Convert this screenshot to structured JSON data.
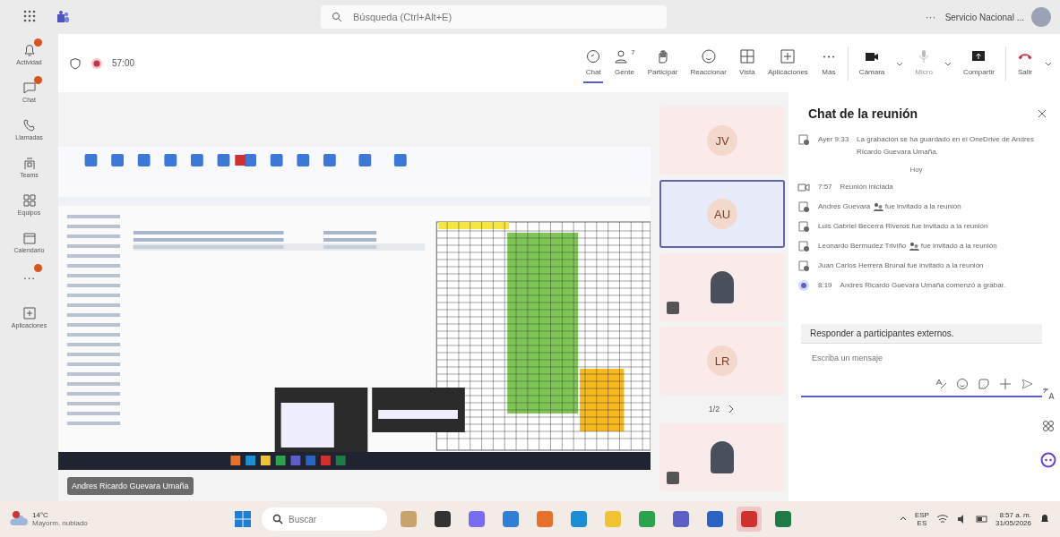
{
  "title_bar": {
    "search": {
      "placeholder": "Búsqueda (Ctrl+Alt+E)"
    },
    "more": "···",
    "account": "Servicio Nacional ..."
  },
  "rail": [
    {
      "kind": "bell",
      "label": "Actividad",
      "badge": true
    },
    {
      "kind": "chat",
      "label": "Chat",
      "badge": true
    },
    {
      "kind": "phone",
      "label": "Llamadas",
      "badge": false
    },
    {
      "kind": "teams",
      "label": "Teams",
      "badge": false
    },
    {
      "kind": "grid",
      "label": "Equipos",
      "badge": false
    },
    {
      "kind": "calendar",
      "label": "Calendario",
      "badge": false
    },
    {
      "kind": "dots",
      "label": "···",
      "badge": true
    },
    {
      "kind": "apps",
      "label": "Aplicaciones",
      "badge": false
    }
  ],
  "meeting": {
    "timer": "57:00",
    "recording": true
  },
  "toolbar": [
    {
      "kind": "chat",
      "label": "Chat",
      "selected": true,
      "disabled": false
    },
    {
      "kind": "people",
      "label": "Gente",
      "selected": false,
      "disabled": false,
      "count": "7"
    },
    {
      "kind": "hand",
      "label": "Participar",
      "selected": false,
      "disabled": false
    },
    {
      "kind": "smile",
      "label": "Reaccionar",
      "selected": false,
      "disabled": false
    },
    {
      "kind": "view",
      "label": "Vista",
      "selected": false,
      "disabled": false
    },
    {
      "kind": "plus",
      "label": "Aplicaciones",
      "selected": false,
      "disabled": false
    },
    {
      "kind": "more",
      "label": "Más",
      "selected": false,
      "disabled": false
    },
    {
      "kind": "camera",
      "label": "Cámara",
      "selected": false,
      "disabled": false,
      "caret": true
    },
    {
      "kind": "mic",
      "label": "Micro",
      "selected": false,
      "disabled": true,
      "caret": true
    },
    {
      "kind": "share",
      "label": "Compartir",
      "selected": false,
      "disabled": false
    },
    {
      "kind": "leave",
      "label": "Salir",
      "selected": false,
      "disabled": false,
      "caret": true
    }
  ],
  "presenter": {
    "name": "Andres Ricardo Guevara Umaña"
  },
  "participants": [
    {
      "kind": "initials",
      "initials": "JV",
      "selected": false
    },
    {
      "kind": "initials",
      "initials": "AU",
      "selected": true
    },
    {
      "kind": "video",
      "selected": false
    },
    {
      "kind": "initials",
      "initials": "LR",
      "selected": false
    },
    {
      "kind": "pager",
      "text": "1/2"
    },
    {
      "kind": "video",
      "selected": false
    }
  ],
  "chat": {
    "title": "Chat de la reunión",
    "messages": [
      {
        "kind": "saved",
        "time": "Ayer 9:33",
        "text": "La grabación se ha guardado en el OneDrive de Andres Ricardo Guevara Umaña."
      },
      {
        "kind": "divider",
        "text": "Hoy"
      },
      {
        "kind": "started",
        "time": "7:57",
        "text": "Reunión iniciada"
      },
      {
        "kind": "invite",
        "name": "Andres Guevara",
        "external": true,
        "text": "fue invitado a la reunión"
      },
      {
        "kind": "invite",
        "text": "Luis Gabriel Becerra Riveros fue invitado a la reunión"
      },
      {
        "kind": "invite",
        "name": "Leonardo Bermudez Triviño",
        "external": true,
        "text": "fue invitado a la reunión"
      },
      {
        "kind": "invite",
        "text": "Juan Carlos Herrera Brunal fue invitado a la reunión"
      },
      {
        "kind": "recording",
        "time": "8:19",
        "text": "Andres Ricardo Guevara Umaña comenzó a grabar."
      }
    ],
    "reply_banner": "Responder a participantes externos.",
    "composer": {
      "placeholder": "Escriba un mensaje"
    }
  },
  "taskbar": {
    "weather": {
      "temp": "14°C",
      "text": "Mayorm. nublado"
    },
    "search": {
      "placeholder": "Buscar"
    },
    "apps": [
      {
        "kind": "widget",
        "selected": false
      },
      {
        "kind": "files",
        "selected": false
      },
      {
        "kind": "copilot",
        "selected": false
      },
      {
        "kind": "store",
        "selected": false
      },
      {
        "kind": "firefox",
        "selected": false
      },
      {
        "kind": "edge",
        "selected": false
      },
      {
        "kind": "folder",
        "selected": false
      },
      {
        "kind": "chrome",
        "selected": false
      },
      {
        "kind": "teams",
        "selected": false
      },
      {
        "kind": "word",
        "selected": false
      },
      {
        "kind": "pdf",
        "selected": true
      },
      {
        "kind": "excel",
        "selected": false
      }
    ],
    "lang": "ESP",
    "region": "ES",
    "time": "8:57 a. m.",
    "date": "31/05/2026"
  }
}
